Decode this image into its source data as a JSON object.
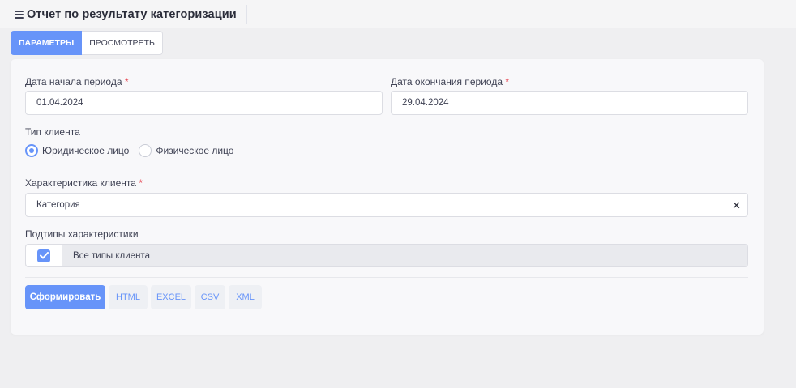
{
  "header": {
    "title": "Отчет по результату категоризации"
  },
  "tabs": [
    {
      "label": "ПАРАМЕТРЫ",
      "active": true
    },
    {
      "label": "ПРОСМОТРЕТЬ",
      "active": false
    }
  ],
  "form": {
    "required_mark": "*",
    "start_date": {
      "label": "Дата начала периода",
      "value": "01.04.2024"
    },
    "end_date": {
      "label": "Дата окончания периода",
      "value": "29.04.2024"
    },
    "client_type": {
      "label": "Тип клиента",
      "options": [
        {
          "label": "Юридическое лицо",
          "checked": true
        },
        {
          "label": "Физическое лицо",
          "checked": false
        }
      ]
    },
    "characteristic": {
      "label": "Характеристика клиента",
      "value": "Категория",
      "clear_glyph": "✕"
    },
    "subtypes": {
      "label": "Подтипы характеристики",
      "checkbox_label": "Все типы клиента",
      "checked": true
    }
  },
  "actions": {
    "generate": "Сформировать",
    "html": "HTML",
    "excel": "EXCEL",
    "csv": "CSV",
    "xml": "XML"
  },
  "colors": {
    "accent": "#6794f9",
    "required": "#e6424e",
    "background": "#efeff1"
  }
}
